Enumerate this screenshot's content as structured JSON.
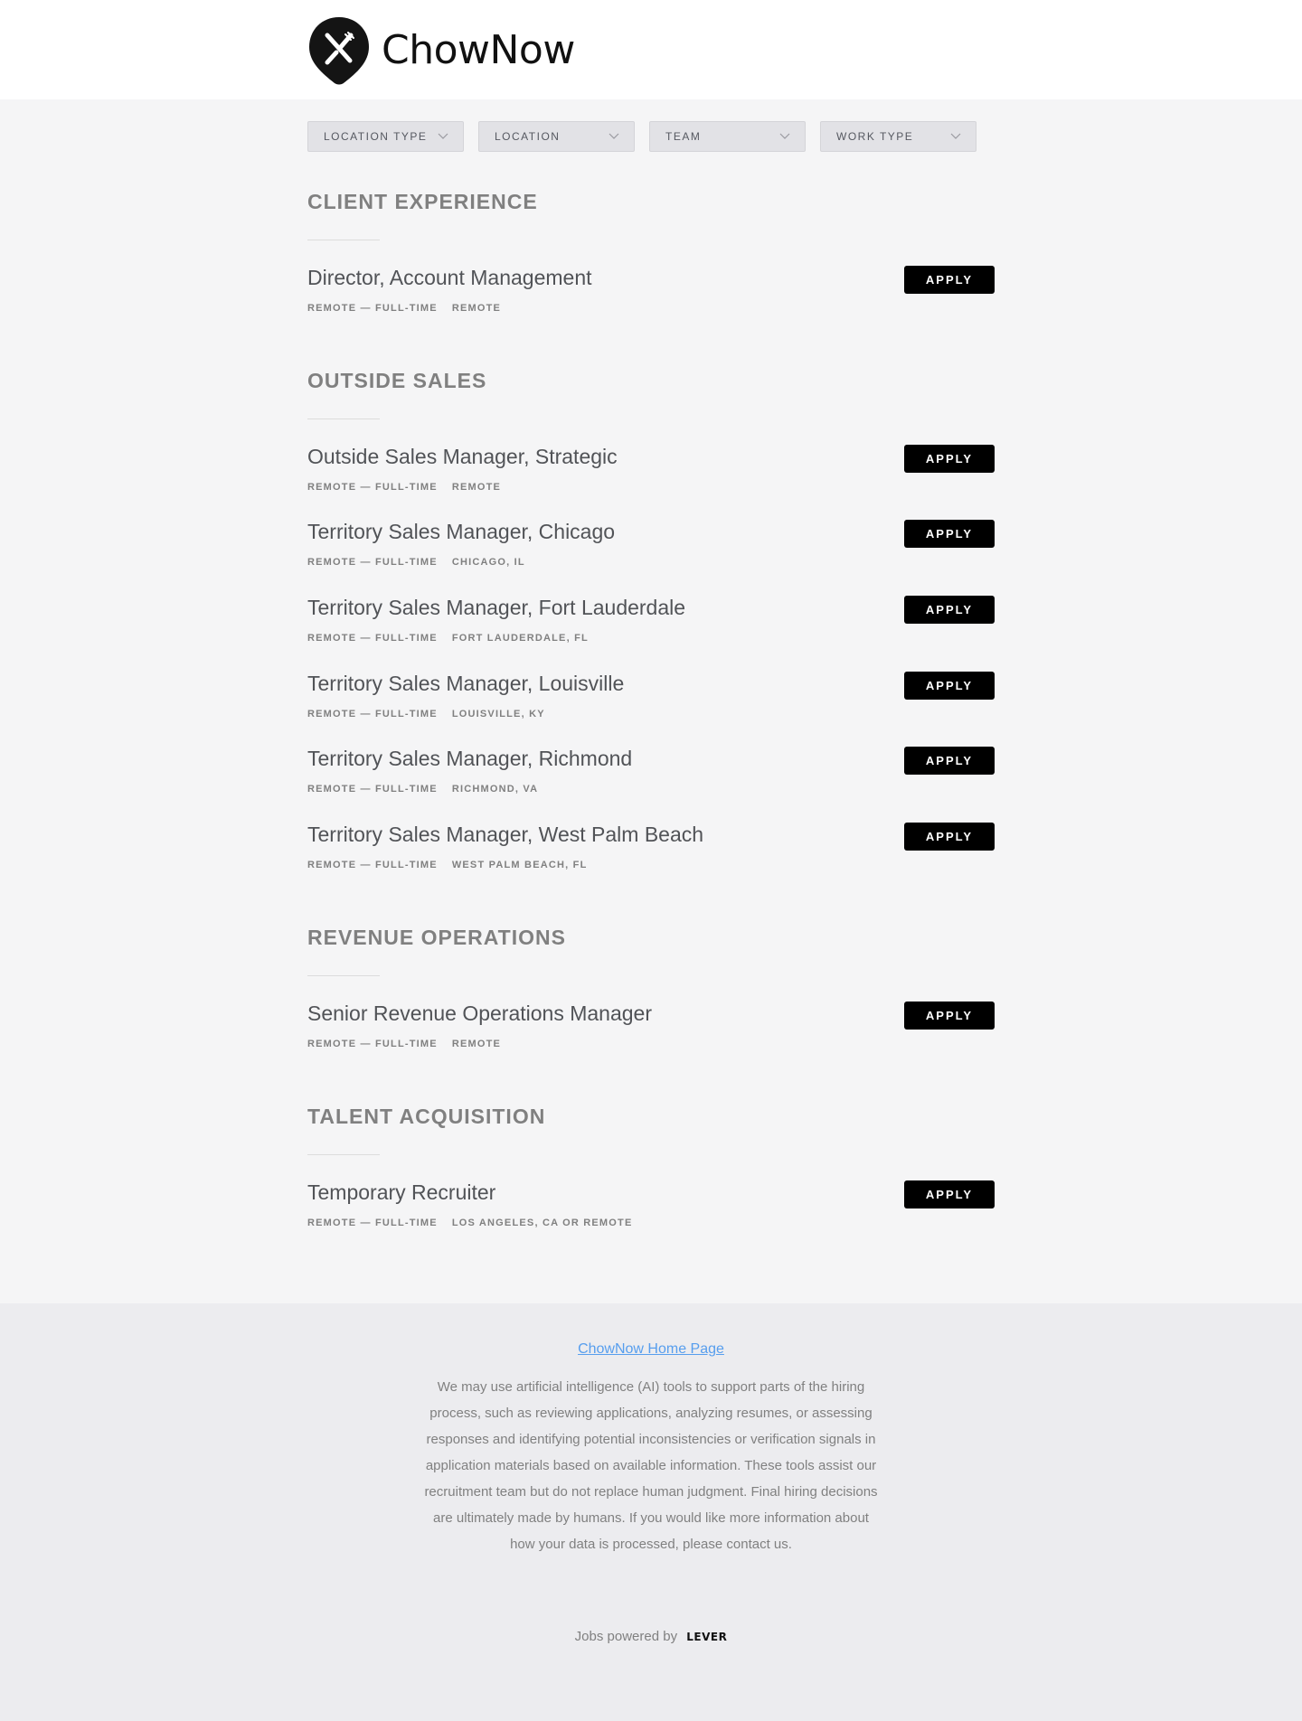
{
  "brand": {
    "name": "ChowNow"
  },
  "filters": [
    {
      "label": "LOCATION TYPE"
    },
    {
      "label": "LOCATION"
    },
    {
      "label": "TEAM"
    },
    {
      "label": "WORK TYPE"
    }
  ],
  "apply_label": "APPLY",
  "teams": [
    {
      "title": "CLIENT EXPERIENCE",
      "postings": [
        {
          "title": "Director, Account Management",
          "commitment": "REMOTE — FULL-TIME",
          "location": "REMOTE"
        }
      ]
    },
    {
      "title": "OUTSIDE SALES",
      "postings": [
        {
          "title": "Outside Sales Manager, Strategic",
          "commitment": "REMOTE — FULL-TIME",
          "location": "REMOTE"
        },
        {
          "title": "Territory Sales Manager, Chicago",
          "commitment": "REMOTE — FULL-TIME",
          "location": "CHICAGO, IL"
        },
        {
          "title": "Territory Sales Manager, Fort Lauderdale",
          "commitment": "REMOTE — FULL-TIME",
          "location": "FORT LAUDERDALE, FL"
        },
        {
          "title": "Territory Sales Manager, Louisville",
          "commitment": "REMOTE — FULL-TIME",
          "location": "LOUISVILLE, KY"
        },
        {
          "title": "Territory Sales Manager, Richmond",
          "commitment": "REMOTE — FULL-TIME",
          "location": "RICHMOND, VA"
        },
        {
          "title": "Territory Sales Manager, West Palm Beach",
          "commitment": "REMOTE — FULL-TIME",
          "location": "WEST PALM BEACH, FL"
        }
      ]
    },
    {
      "title": "REVENUE OPERATIONS",
      "postings": [
        {
          "title": "Senior Revenue Operations Manager",
          "commitment": "REMOTE — FULL-TIME",
          "location": "REMOTE"
        }
      ]
    },
    {
      "title": "TALENT ACQUISITION",
      "postings": [
        {
          "title": "Temporary Recruiter",
          "commitment": "REMOTE — FULL-TIME",
          "location": "LOS ANGELES, CA OR REMOTE"
        }
      ]
    }
  ],
  "footer": {
    "home_link": "ChowNow Home Page",
    "disclaimer": "We may use artificial intelligence (AI) tools to support parts of the hiring process, such as reviewing applications, analyzing resumes, or assessing responses and identifying potential inconsistencies or verification signals in application materials based on available information. These tools assist our recruitment team but do not replace human judgment. Final hiring decisions are ultimately made by humans. If you would like more information about how your data is processed, please contact us.",
    "powered_prefix": "Jobs powered by",
    "powered_brand": "LEVER"
  },
  "colors": {
    "accent_button": "#000000",
    "link": "#579eee",
    "page_bg": "#f5f5f6",
    "footer_bg": "#ececef"
  }
}
